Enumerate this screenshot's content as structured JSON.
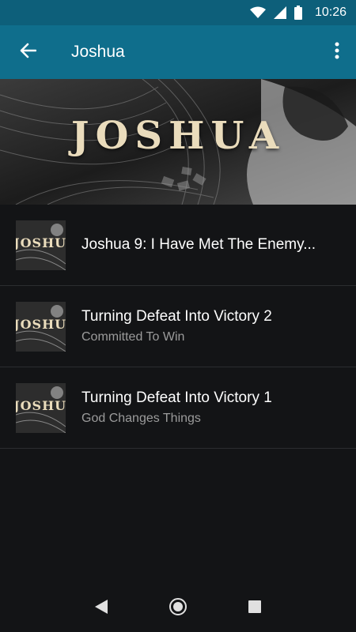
{
  "status_bar": {
    "time": "10:26"
  },
  "app_bar": {
    "title": "Joshua"
  },
  "hero": {
    "title": "JOSHUA"
  },
  "thumb_text": "JOSHUA",
  "items": [
    {
      "title": "Joshua 9: I Have Met The Enemy...",
      "subtitle": ""
    },
    {
      "title": "Turning Defeat Into Victory 2",
      "subtitle": "Committed To Win"
    },
    {
      "title": "Turning Defeat Into Victory 1",
      "subtitle": "God Changes Things"
    }
  ],
  "colors": {
    "status_bar": "#0d5f7a",
    "app_bar": "#0f6e8c",
    "background": "#131416",
    "divider": "#2b2d30",
    "subtitle": "#9b9b9b",
    "hero_text": "#eadcbc"
  }
}
